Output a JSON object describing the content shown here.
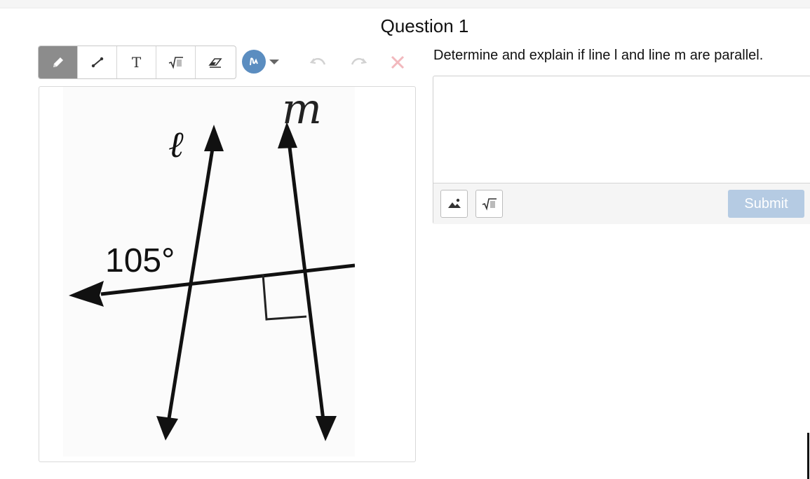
{
  "question": {
    "title": "Question 1"
  },
  "drawing_toolbar": {
    "tools": [
      {
        "name": "pencil-icon",
        "active": true
      },
      {
        "name": "line-icon",
        "active": false
      },
      {
        "name": "text-icon",
        "glyph": "T",
        "active": false
      },
      {
        "name": "math-icon",
        "active": false
      },
      {
        "name": "eraser-icon",
        "active": false
      }
    ],
    "color": "#5b8dc0",
    "undo_enabled": false,
    "redo_enabled": false,
    "clear_color": "#f2b8bd"
  },
  "figure": {
    "line_label_l": "ℓ",
    "line_label_m": "m",
    "angle_label": "105°"
  },
  "prompt": {
    "text": "Determine and explain if line l and line m are parallel."
  },
  "answer": {
    "value": "",
    "submit_label": "Submit",
    "submit_color": "#b5cbe3"
  }
}
